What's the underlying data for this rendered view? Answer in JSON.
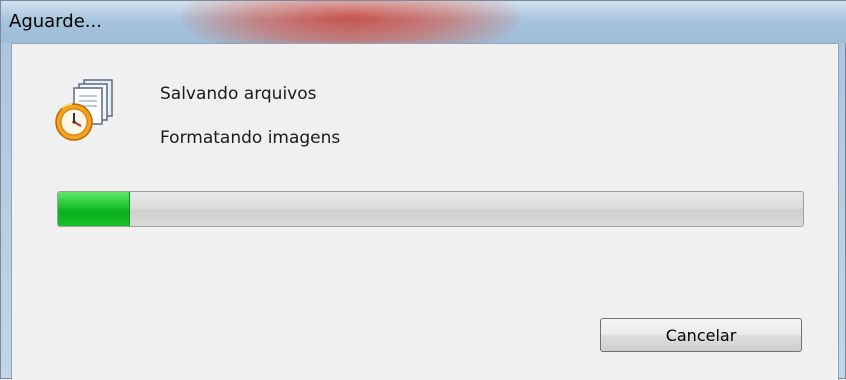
{
  "window": {
    "title": "Aguarde..."
  },
  "dialog": {
    "icon": "clock-documents-icon",
    "message_primary": "Salvando arquivos",
    "message_secondary": "Formatando imagens",
    "progress_fraction": 0.095,
    "progress_color": "#1cc02a",
    "cancel_label": "Cancelar"
  }
}
